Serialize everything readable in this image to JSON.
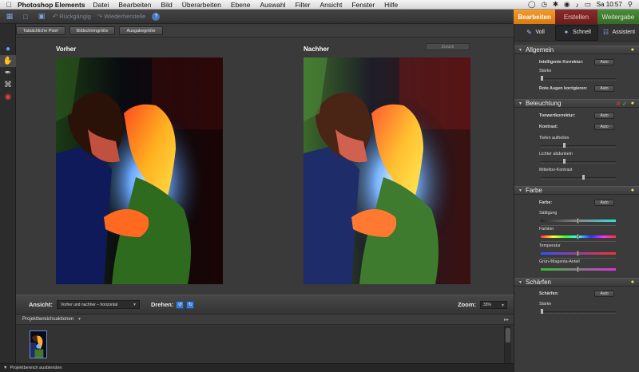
{
  "menubar": {
    "apple": "",
    "app_name": "Photoshop Elements",
    "menus": [
      "Datei",
      "Bearbeiten",
      "Bild",
      "Überarbeiten",
      "Ebene",
      "Auswahl",
      "Filter",
      "Ansicht",
      "Fenster",
      "Hilfe"
    ],
    "clock": "Sa 10:57"
  },
  "toolbar": {
    "undo_label": "Rückgängig",
    "redo_label": "Wiederherstelle"
  },
  "mode_tabs": {
    "edit": "Bearbeiten",
    "create": "Erstellen",
    "share": "Weitergabe"
  },
  "view_buttons": {
    "actual_pixels": "Tatsächliche Pixel",
    "fit_screen": "Bildschirmgröße",
    "print_size": "Ausgabegröße"
  },
  "canvas": {
    "before_label": "Vorher",
    "after_label": "Nachher",
    "reset_label": "Zurück"
  },
  "viewstrip": {
    "view_label": "Ansicht:",
    "view_value": "Vorher und nachher – horizontal",
    "rotate_label": "Drehen:",
    "zoom_label": "Zoom:",
    "zoom_value": "33%"
  },
  "project_bin": {
    "title": "Projektbereichsaktionen"
  },
  "statusbar": {
    "hide_label": "Projektbereich ausblenden"
  },
  "panel": {
    "modes": {
      "full": "Voll",
      "quick": "Schnell",
      "guided": "Assistent"
    },
    "sections": {
      "general": {
        "title": "Allgemein",
        "smart_fix": "Intelligente Korrektur:",
        "strength": "Stärke",
        "red_eye": "Rote Augen korrigieren:",
        "auto": "Auto"
      },
      "lighting": {
        "title": "Beleuchtung",
        "levels": "Tonwertkorrektur:",
        "contrast": "Kontrast:",
        "shadows": "Tiefen aufhellen",
        "highlights": "Lichter abdunkeln",
        "midtone": "Mittelton-Kontrast",
        "auto": "Auto"
      },
      "color": {
        "title": "Farbe",
        "color": "Farbe:",
        "saturation": "Sättigung",
        "hue": "Farbton",
        "temperature": "Temperatur",
        "tint": "Grün-/Magenta-Anteil",
        "auto": "Auto"
      },
      "sharpen": {
        "title": "Schärfen",
        "sharpen": "Schärfen:",
        "strength": "Stärke",
        "auto": "Auto"
      }
    }
  },
  "colors": {
    "accent": "#e88a1e",
    "create": "#7a2424",
    "share": "#427c32"
  }
}
